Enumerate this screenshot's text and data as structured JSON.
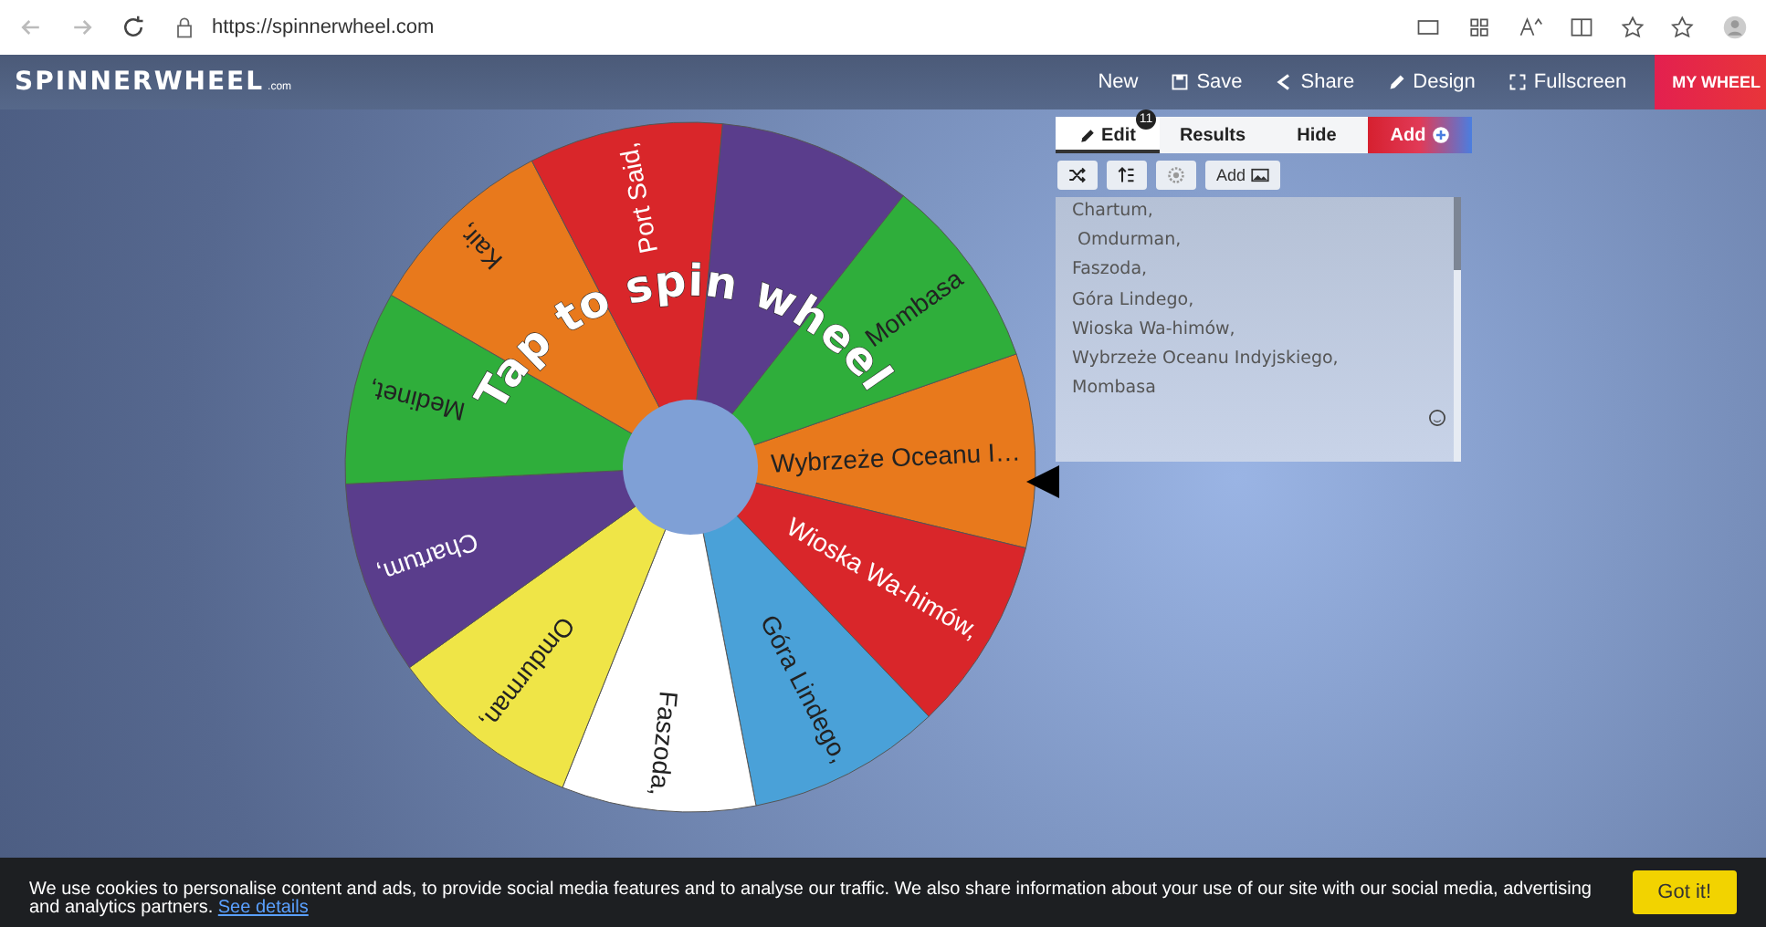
{
  "browser": {
    "url": "https://spinnerwheel.com"
  },
  "nav": {
    "logo": "SPINNERWHEEL",
    "logo_suffix": ".com",
    "items": [
      {
        "label": "New"
      },
      {
        "label": "Save"
      },
      {
        "label": "Share"
      },
      {
        "label": "Design"
      },
      {
        "label": "Fullscreen"
      }
    ],
    "my_wheels": "MY WHEEL"
  },
  "wheel": {
    "prompt": "Tap to spin wheel",
    "slices": [
      {
        "label": "Wybrzeże Oceanu I…",
        "color": "#e8791c"
      },
      {
        "label": "Wioska Wa-himów,",
        "color": "#d9262a"
      },
      {
        "label": "Góra Lindego,",
        "color": "#4aa1d8"
      },
      {
        "label": "Faszoda,",
        "color": "#ffffff"
      },
      {
        "label": "Omdurman,",
        "color": "#efe547"
      },
      {
        "label": "Chartum,",
        "color": "#5a3d8c"
      },
      {
        "label": "Medinet,",
        "color": "#2fae3b"
      },
      {
        "label": "Kair,",
        "color": "#e8791c"
      },
      {
        "label": "Port Said,",
        "color": "#d9262a"
      },
      {
        "color": "#5a3d8c"
      },
      {
        "label": "Mombasa",
        "color": "#2fae3b"
      }
    ]
  },
  "editor": {
    "tabs": [
      {
        "label": "Edit",
        "badge": "11",
        "selected": true
      },
      {
        "label": "Results",
        "selected": false
      },
      {
        "label": "Hide",
        "selected": false
      }
    ],
    "add_button": "Add",
    "tools": [
      {
        "kind": "shuffle"
      },
      {
        "kind": "sort"
      },
      {
        "kind": "settings"
      },
      {
        "kind": "image",
        "label": "Add"
      }
    ],
    "entries": [
      "Chartum,",
      " Omdurman,",
      "Faszoda,",
      "Góra Lindego,",
      "Wioska Wa-himów,",
      "Wybrzeże Oceanu Indyjskiego,",
      "Mombasa"
    ]
  },
  "cookie": {
    "text": "We use cookies to personalise content and ads, to provide social media features and to analyse our traffic. We also share information about your use of our site with our social media, advertising and analytics partners.",
    "link": "See details",
    "button": "Got it!"
  }
}
